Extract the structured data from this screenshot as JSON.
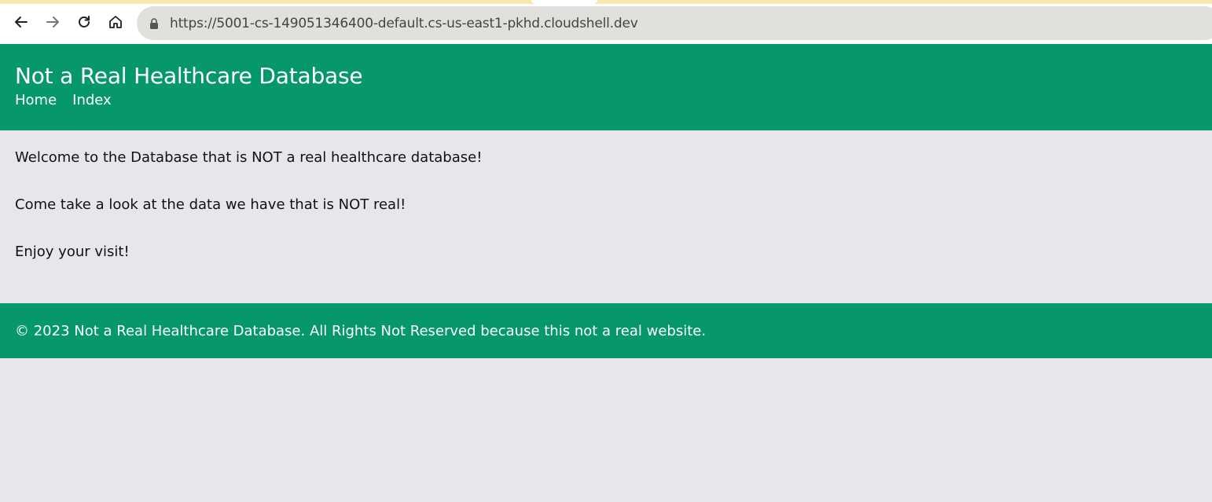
{
  "browser": {
    "url": "https://5001-cs-149051346400-default.cs-us-east1-pkhd.cloudshell.dev",
    "icons": [
      "back-arrow-icon",
      "forward-arrow-icon",
      "reload-icon",
      "home-icon",
      "lock-icon"
    ]
  },
  "header": {
    "title": "Not a Real Healthcare Database",
    "nav": [
      {
        "label": "Home"
      },
      {
        "label": "Index"
      }
    ]
  },
  "main": {
    "paragraphs": [
      "Welcome to the Database that is NOT a real healthcare database!",
      "Come take a look at the data we have that is NOT real!",
      "Enjoy your visit!"
    ]
  },
  "footer": {
    "text": "© 2023 Not a Real Healthcare Database. All Rights Not Reserved because this not a real website."
  },
  "colors": {
    "brand": "#06976a",
    "page_bg": "#e5e7eb"
  }
}
